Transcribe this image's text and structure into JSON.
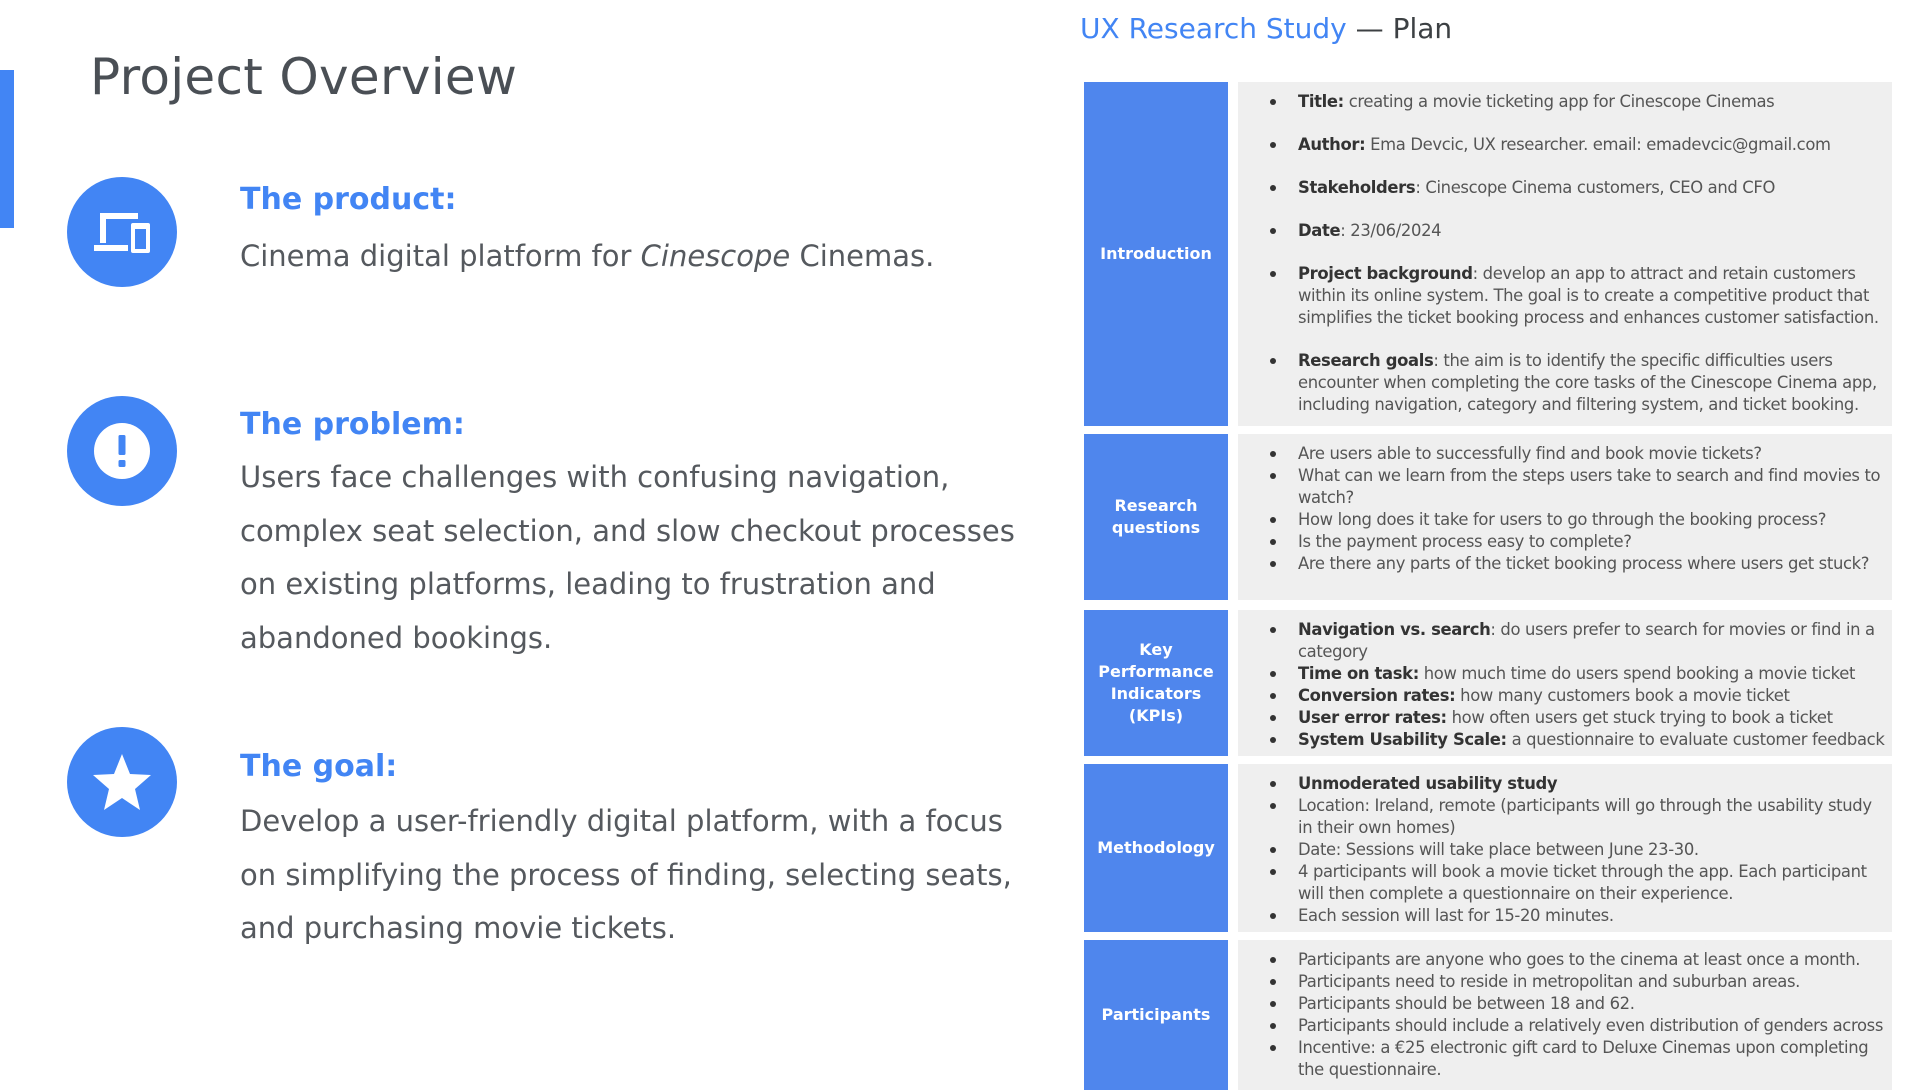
{
  "overview": {
    "title": "Project Overview",
    "sections": [
      {
        "icon": "devices-icon",
        "heading": "The product:",
        "body_before": "Cinema digital platform for ",
        "body_italic": "Cinescope",
        "body_after": " Cinemas."
      },
      {
        "icon": "exclamation-icon",
        "heading": "The problem:",
        "body": "Users face challenges with confusing navigation, complex seat selection, and slow checkout processes on existing platforms, leading to frustration and abandoned bookings."
      },
      {
        "icon": "star-icon",
        "heading": "The goal:",
        "body": "Develop a user-friendly digital platform, with a focus on simplifying the process of finding, selecting seats, and purchasing movie tickets."
      }
    ]
  },
  "plan": {
    "title_main": "UX Research Study",
    "title_sep": " — ",
    "title_sub": "Plan",
    "rows": [
      {
        "label": "Introduction",
        "items": [
          {
            "bold": "Title:",
            "text": " creating a movie ticketing app for Cinescope Cinemas"
          },
          {
            "bold": "Author:",
            "text": " Ema Devcic, UX researcher. email: emadevcic@gmail.com"
          },
          {
            "bold": "Stakeholders",
            "text": ": Cinescope Cinema customers, CEO and CFO"
          },
          {
            "bold": "Date",
            "text": ": 23/06/2024"
          },
          {
            "bold": "Project background",
            "text": ": develop an app to attract and retain customers within its online system. The goal is to create a competitive product that simplifies the ticket booking process and enhances customer satisfaction."
          },
          {
            "bold": "Research goals",
            "text": ": the aim is to identify the specific difficulties users encounter when completing the core tasks of the Cinescope Cinema app, including navigation, category and filtering system, and ticket booking."
          }
        ]
      },
      {
        "label": "Research questions",
        "items": [
          {
            "bold": "",
            "text": "Are users able to successfully find and book movie tickets?"
          },
          {
            "bold": "",
            "text": "What can we learn from the steps users take to search and find movies to watch?"
          },
          {
            "bold": "",
            "text": "How long does it take for users to go through the booking process?"
          },
          {
            "bold": "",
            "text": "Is the payment process easy to complete?"
          },
          {
            "bold": "",
            "text": "Are there any parts of the ticket booking process where users get stuck?"
          }
        ]
      },
      {
        "label": "Key Performance Indicators (KPIs)",
        "items": [
          {
            "bold": "Navigation vs. search",
            "text": ": do users prefer to search for movies or find in a category"
          },
          {
            "bold": "Time on task:",
            "text": " how much time do users spend booking a movie ticket"
          },
          {
            "bold": "Conversion rates:",
            "text": " how many customers book a movie ticket"
          },
          {
            "bold": "User error rates:",
            "text": " how often users get stuck trying to book a ticket"
          },
          {
            "bold": "System Usability Scale:",
            "text": " a questionnaire to evaluate customer feedback"
          }
        ]
      },
      {
        "label": "Methodology",
        "items": [
          {
            "bold": "Unmoderated usability study",
            "text": ""
          },
          {
            "bold": "",
            "text": "Location: Ireland, remote (participants will go through the usability study in their own homes)"
          },
          {
            "bold": "",
            "text": "Date: Sessions will take place between June 23-30."
          },
          {
            "bold": "",
            "text": "4 participants will book a movie ticket through the app. Each participant will then complete a questionnaire on their experience."
          },
          {
            "bold": "",
            "text": "Each session will last for 15-20 minutes."
          }
        ]
      },
      {
        "label": "Participants",
        "items": [
          {
            "bold": "",
            "text": "Participants are anyone who goes to the cinema at least once a month."
          },
          {
            "bold": "",
            "text": "Participants need to reside in metropolitan and suburban areas."
          },
          {
            "bold": "",
            "text": "Participants should be between 18 and 62."
          },
          {
            "bold": "",
            "text": "Participants should include a relatively even distribution of genders across"
          },
          {
            "bold": "",
            "text": "Incentive: a €25 electronic gift card to  Deluxe Cinemas upon completing the questionnaire."
          }
        ]
      }
    ]
  }
}
